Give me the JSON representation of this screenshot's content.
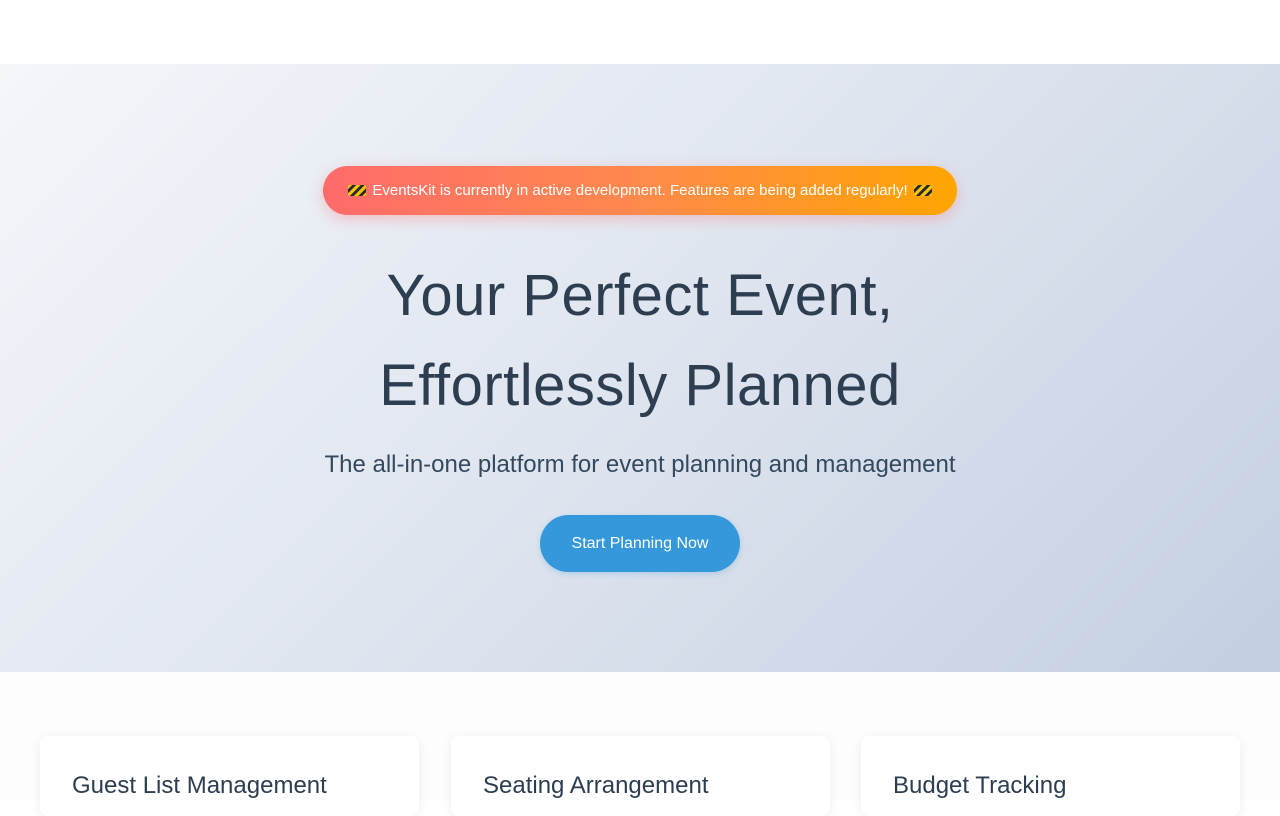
{
  "banner": {
    "text": "EventsKit is currently in active development. Features are being added regularly!",
    "icon": "construction-icon"
  },
  "hero": {
    "title_line1": "Your Perfect Event,",
    "title_line2": "Effortlessly Planned",
    "subtitle": "The all-in-one platform for event planning and management",
    "cta_label": "Start Planning Now"
  },
  "features": [
    {
      "title": "Guest List Management"
    },
    {
      "title": "Seating Arrangement"
    },
    {
      "title": "Budget Tracking"
    }
  ],
  "colors": {
    "accent": "#3498db",
    "banner_start": "#ff6b6b",
    "banner_end": "#ffa500",
    "heading": "#2c3e50"
  }
}
